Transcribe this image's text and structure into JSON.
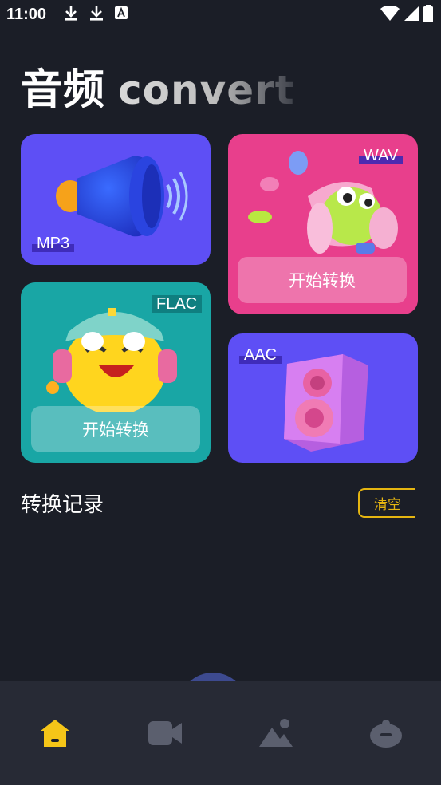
{
  "status_bar": {
    "time": "11:00",
    "left_icons": [
      "download-icon",
      "download-icon",
      "text-a-icon"
    ],
    "right_icons": [
      "wifi-icon",
      "signal-icon",
      "battery-icon"
    ]
  },
  "header": {
    "title_cn": "音频",
    "title_en": "convert"
  },
  "cards": {
    "mp3": {
      "label": "MP3",
      "color": "#5e4ff5",
      "illustration": "speaker-horn-icon"
    },
    "wav": {
      "label": "WAV",
      "color": "#e83f8c",
      "button": "开始转换",
      "illustration": "frog-horn-icon"
    },
    "flac": {
      "label": "FLAC",
      "color": "#19a6a5",
      "button": "开始转换",
      "illustration": "headphone-character-icon"
    },
    "aac": {
      "label": "AAC",
      "color": "#5e4ff5",
      "illustration": "loudspeaker-box-icon"
    }
  },
  "history": {
    "title": "转换记录",
    "clear_label": "清空"
  },
  "bottom_nav": {
    "items": [
      {
        "name": "home-icon",
        "active": true
      },
      {
        "name": "video-icon",
        "active": false
      },
      {
        "name": "image-icon",
        "active": false
      },
      {
        "name": "profile-icon",
        "active": false
      }
    ],
    "accent": "#f5c518"
  }
}
